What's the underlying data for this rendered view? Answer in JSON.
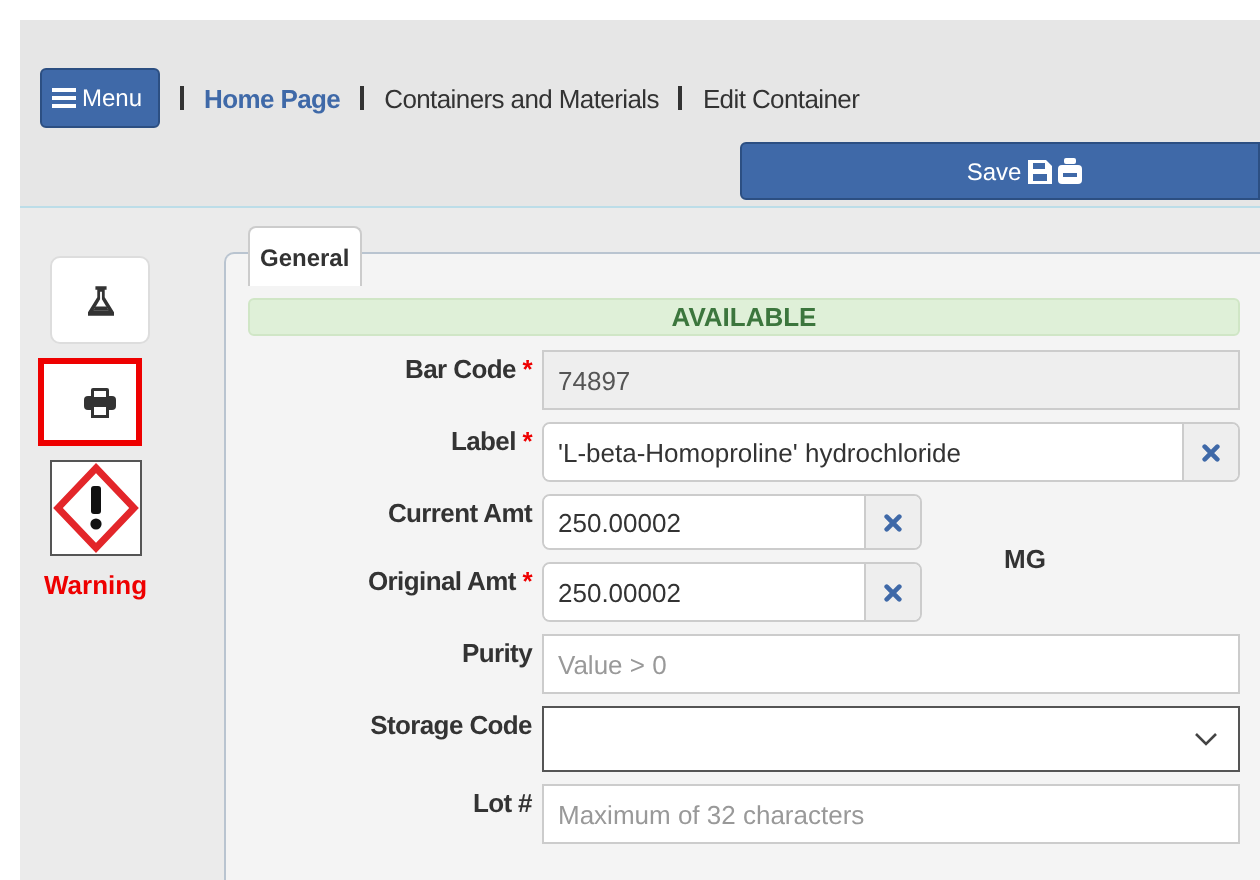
{
  "menu_button": {
    "label": "Menu"
  },
  "breadcrumbs": [
    {
      "label": "Home Page",
      "kind": "link"
    },
    {
      "label": "Containers and Materials",
      "kind": "text"
    },
    {
      "label": "Edit Container",
      "kind": "text"
    }
  ],
  "save_button": {
    "label": "Save"
  },
  "tools": [
    {
      "kind": "flask",
      "selected": false
    },
    {
      "kind": "print",
      "selected": true
    }
  ],
  "hazard": {
    "label": "Warning"
  },
  "tab": {
    "label": "General"
  },
  "status": "AVAILABLE",
  "unit": "MG",
  "fields": [
    {
      "label": "Bar Code",
      "required_mark": "*",
      "kind": "readonly",
      "value": "74897"
    },
    {
      "label": "Label",
      "required_mark": "*",
      "kind": "clear",
      "value": "'L-beta-Homoproline' hydrochloride"
    },
    {
      "label": "Current Amt",
      "kind": "amount",
      "value": "250.00002"
    },
    {
      "label": "Original Amt",
      "required_mark": "*",
      "kind": "amount",
      "value": "250.00002"
    },
    {
      "label": "Purity",
      "kind": "text",
      "placeholder": "Value > 0"
    },
    {
      "label": "Storage Code",
      "kind": "select"
    },
    {
      "label": "Lot #",
      "kind": "text",
      "placeholder": "Maximum of 32 characters"
    }
  ]
}
